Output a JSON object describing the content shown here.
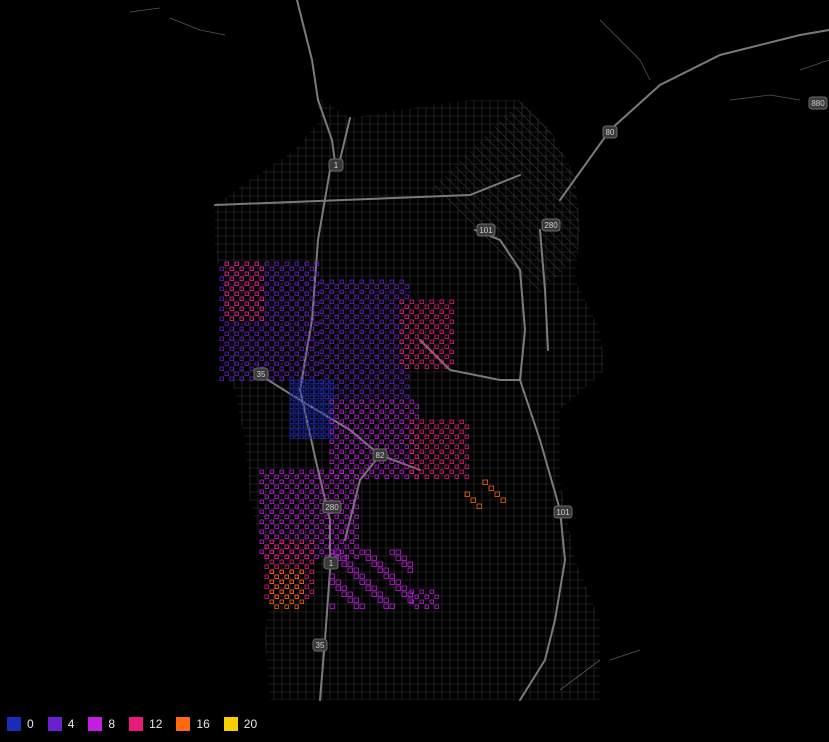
{
  "map": {
    "base_color": "#000000",
    "road_color": "#4a4a4a",
    "highway_shields": [
      "1",
      "101",
      "280",
      "80",
      "880",
      "35",
      "82",
      "280",
      "1",
      "35",
      "101"
    ]
  },
  "legend": {
    "items": [
      {
        "label": "0",
        "color": "#1a2bb5"
      },
      {
        "label": "4",
        "color": "#6a1fd0"
      },
      {
        "label": "8",
        "color": "#c21ee0"
      },
      {
        "label": "12",
        "color": "#e81a7a"
      },
      {
        "label": "16",
        "color": "#ff6a10"
      },
      {
        "label": "20",
        "color": "#f5d000"
      }
    ]
  }
}
